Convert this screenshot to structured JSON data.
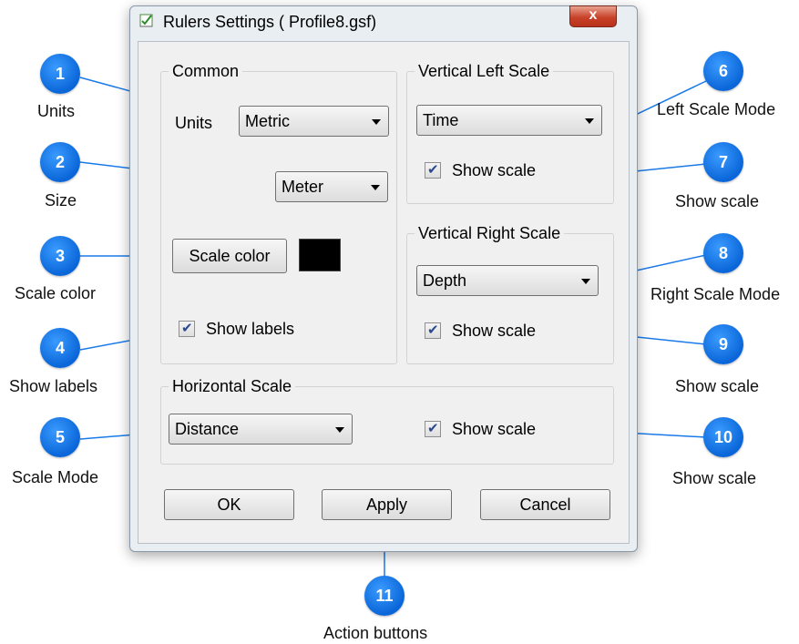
{
  "dialog": {
    "title": "Rulers Settings ( Profile8.gsf)",
    "close_label": "x"
  },
  "common": {
    "title": "Common",
    "units_label": "Units",
    "units_value": "Metric",
    "size_value": "Meter",
    "scale_color_label": "Scale color",
    "scale_color_value": "#000000",
    "show_labels_label": "Show labels",
    "show_labels_checked": true
  },
  "vertical_left": {
    "title": "Vertical Left Scale",
    "mode_value": "Time",
    "show_scale_label": "Show scale",
    "show_scale_checked": true
  },
  "vertical_right": {
    "title": "Vertical Right Scale",
    "mode_value": "Depth",
    "show_scale_label": "Show scale",
    "show_scale_checked": true
  },
  "horizontal": {
    "title": "Horizontal Scale",
    "mode_value": "Distance",
    "show_scale_label": "Show scale",
    "show_scale_checked": true
  },
  "buttons": {
    "ok": "OK",
    "apply": "Apply",
    "cancel": "Cancel"
  },
  "callouts": [
    {
      "number": "1",
      "caption": "Units"
    },
    {
      "number": "2",
      "caption": "Size"
    },
    {
      "number": "3",
      "caption": "Scale color"
    },
    {
      "number": "4",
      "caption": "Show labels"
    },
    {
      "number": "5",
      "caption": "Scale Mode"
    },
    {
      "number": "6",
      "caption": "Left Scale Mode"
    },
    {
      "number": "7",
      "caption": "Show scale"
    },
    {
      "number": "8",
      "caption": "Right Scale Mode"
    },
    {
      "number": "9",
      "caption": "Show scale"
    },
    {
      "number": "10",
      "caption": "Show scale"
    },
    {
      "number": "11",
      "caption": "Action buttons"
    }
  ],
  "colors": {
    "callout": "#1a7ae8",
    "leader_line": "#1a7ae8"
  }
}
